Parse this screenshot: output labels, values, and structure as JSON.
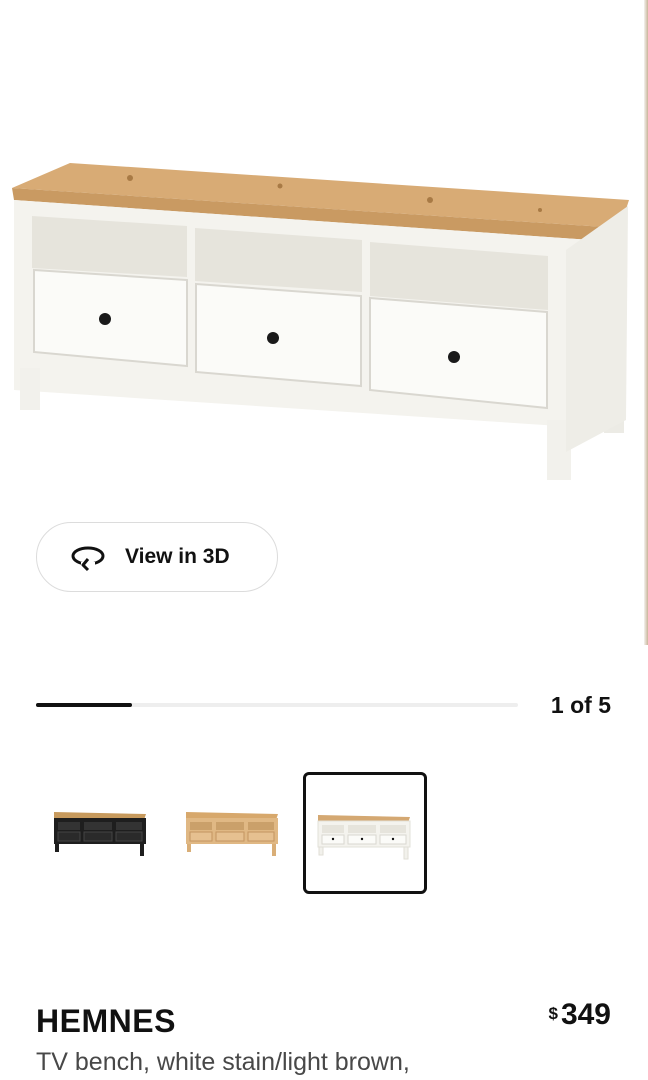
{
  "gallery": {
    "view_3d_label": "View in 3D",
    "current_image": 1,
    "total_images": 5,
    "counter_text": "1 of 5",
    "progress_fraction": 0.2
  },
  "thumbnails": [
    {
      "variant": "black-brown/light brown",
      "selected": false
    },
    {
      "variant": "light brown",
      "selected": false
    },
    {
      "variant": "white stain/light brown",
      "selected": true
    }
  ],
  "product": {
    "name": "HEMNES",
    "description": "TV bench, white stain/light brown,",
    "currency_symbol": "$",
    "price": "349"
  },
  "colors": {
    "text": "#111111",
    "muted_text": "#484848",
    "wood": "#d4a872",
    "white_stain": "#f7f6f1"
  }
}
